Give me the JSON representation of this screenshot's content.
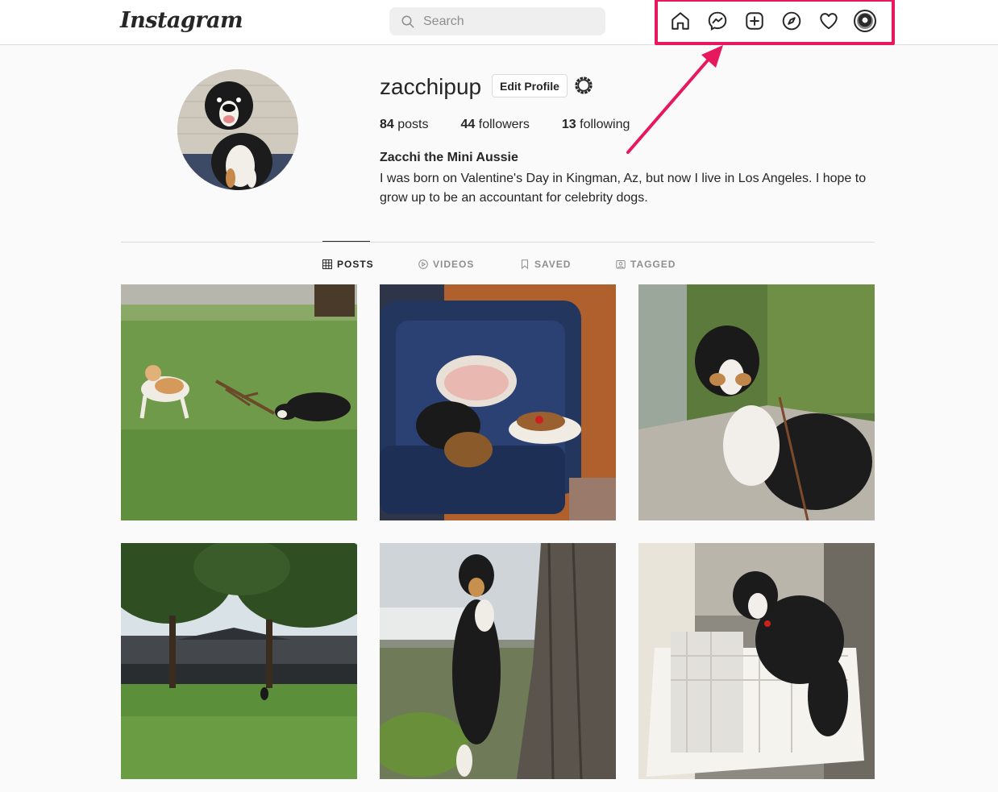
{
  "header": {
    "logo_text": "Instagram",
    "search_placeholder": "Search",
    "icons": [
      "home-icon",
      "messenger-icon",
      "new-post-icon",
      "explore-icon",
      "activity-heart-icon",
      "profile-avatar-icon"
    ]
  },
  "annotation": {
    "highlight_color": "#e8185e"
  },
  "profile": {
    "username": "zacchipup",
    "edit_button": "Edit Profile",
    "stats": {
      "posts_count": "84",
      "posts_label": "posts",
      "followers_count": "44",
      "followers_label": "followers",
      "following_count": "13",
      "following_label": "following"
    },
    "full_name": "Zacchi the Mini Aussie",
    "bio": "I was born on Valentine's Day in Kingman, Az, but now I live in Los Angeles. I hope to grow up to be an accountant for celebrity dogs."
  },
  "tabs": [
    {
      "label": "POSTS",
      "icon": "grid-icon",
      "active": true
    },
    {
      "label": "VIDEOS",
      "icon": "play-icon",
      "active": false
    },
    {
      "label": "SAVED",
      "icon": "bookmark-icon",
      "active": false
    },
    {
      "label": "TAGGED",
      "icon": "tag-icon",
      "active": false
    }
  ],
  "posts": [
    {
      "subject": "two dogs playing with a stick on grass"
    },
    {
      "subject": "dog lying upside down on a blue couch"
    },
    {
      "subject": "dog sitting on a ledge by plants"
    },
    {
      "subject": "dog sitting in a park with trees"
    },
    {
      "subject": "dog standing up against a tree trunk"
    },
    {
      "subject": "dog standing in an open dishwasher"
    }
  ]
}
